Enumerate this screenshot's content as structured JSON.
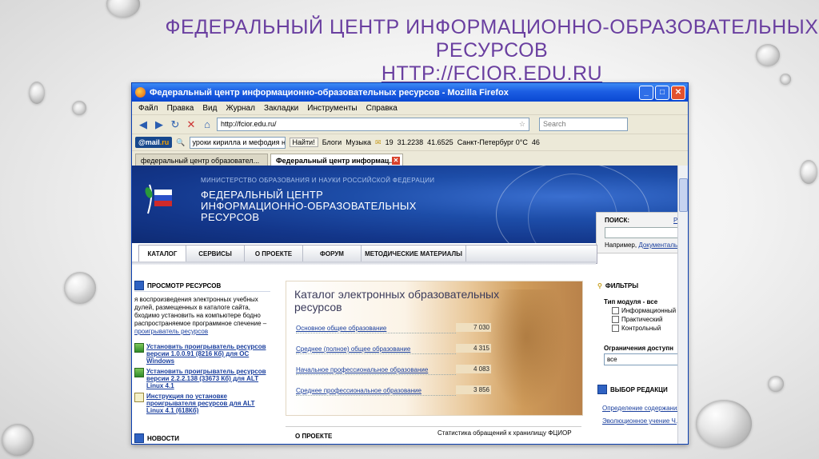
{
  "slide": {
    "title_line1": "ФЕДЕРАЛЬНЫЙ ЦЕНТР ИНФОРМАЦИОННО-ОБРАЗОВАТЕЛЬНЫХ",
    "title_line2": "РЕСУРСОВ",
    "url": "HTTP://FCIOR.EDU.RU",
    "title_color": "#6a3fa0"
  },
  "window": {
    "title": "Федеральный центр информационно-образовательных ресурсов - Mozilla Firefox",
    "menu": [
      "Файл",
      "Правка",
      "Вид",
      "Журнал",
      "Закладки",
      "Инструменты",
      "Справка"
    ],
    "address": "http://fcior.edu.ru/",
    "search_placeholder": "Search",
    "toolbar2": {
      "mailru_left": "@mail",
      "mailru_right": ".ru",
      "query": "уроки кирилла и мефодия на",
      "find_btn": "Найти!",
      "blogs": "Блоги",
      "music": "Музыка",
      "count": "19",
      "usd": "31.2238",
      "eur": "41.6525",
      "weather": "Санкт-Петербург 0°С",
      "num2": "46"
    },
    "tabs": [
      {
        "label": "федеральный центр образовател...",
        "active": false
      },
      {
        "label": "Федеральный центр информац...",
        "active": true
      }
    ]
  },
  "site": {
    "ministry": "МИНИСТЕРСТВО ОБРАЗОВАНИЯ И НАУКИ РОССИЙСКОЙ ФЕДЕРАЦИИ",
    "name": "ФЕДЕРАЛЬНЫЙ ЦЕНТР ИНФОРМАЦИОННО-ОБРАЗОВАТЕЛЬНЫХ РЕСУРСОВ",
    "search": {
      "label": "ПОИСК:",
      "right": "Р",
      "example_prefix": "Например,",
      "example_link": "Документальн"
    },
    "nav": [
      "КАТАЛОГ",
      "СЕРВИСЫ",
      "О ПРОЕКТЕ",
      "ФОРУМ",
      "МЕТОДИЧЕСКИЕ МАТЕРИАЛЫ"
    ],
    "left": {
      "heading": "ПРОСМОТР РЕСУРСОВ",
      "text": "я воспроизведения электронных учебных дулей, размещенных в каталоге сайта, бходимо установить на компьютере бодно распространяемое программное спечение – ",
      "text_link": "проигрыватель ресурсов",
      "links": [
        "Установить проигрыватель ресурсов версии 1.0.0.91 (8216 Кб) для ОС Windows",
        "Установить проигрыватель ресурсов версии 2.2.2.138 (33673 Кб) для ALT Linux 4.1",
        "Инструкция по установке проигрывателя ресурсов для ALT Linux 4.1 (618Кб)"
      ],
      "news": "НОВОСТИ"
    },
    "catalog": {
      "title": "Каталог электронных образовательных ресурсов",
      "rows": [
        {
          "label": "Основное общее образование",
          "count": "7 030"
        },
        {
          "label": "Среднее (полное) общее образование",
          "count": "4 315"
        },
        {
          "label": "Начальное профессиональное образование",
          "count": "4 083"
        },
        {
          "label": "Среднее профессиональное образование",
          "count": "3 856"
        }
      ]
    },
    "bottom": {
      "about": "О ПРОЕКТЕ",
      "stats": "Статистика обращений к хранилищу ФЦИОР"
    },
    "right": {
      "filters": "ФИЛЬТРЫ",
      "module_type": "Тип модуля - все",
      "options": [
        "Информационный",
        "Практический",
        "Контрольный"
      ],
      "restriction": "Ограничения доступн",
      "restriction_value": "все",
      "editors": "ВЫБОР РЕДАКЦИ",
      "links": [
        "Определение содержания",
        "Эволюционное учение Ч.Д"
      ]
    }
  }
}
